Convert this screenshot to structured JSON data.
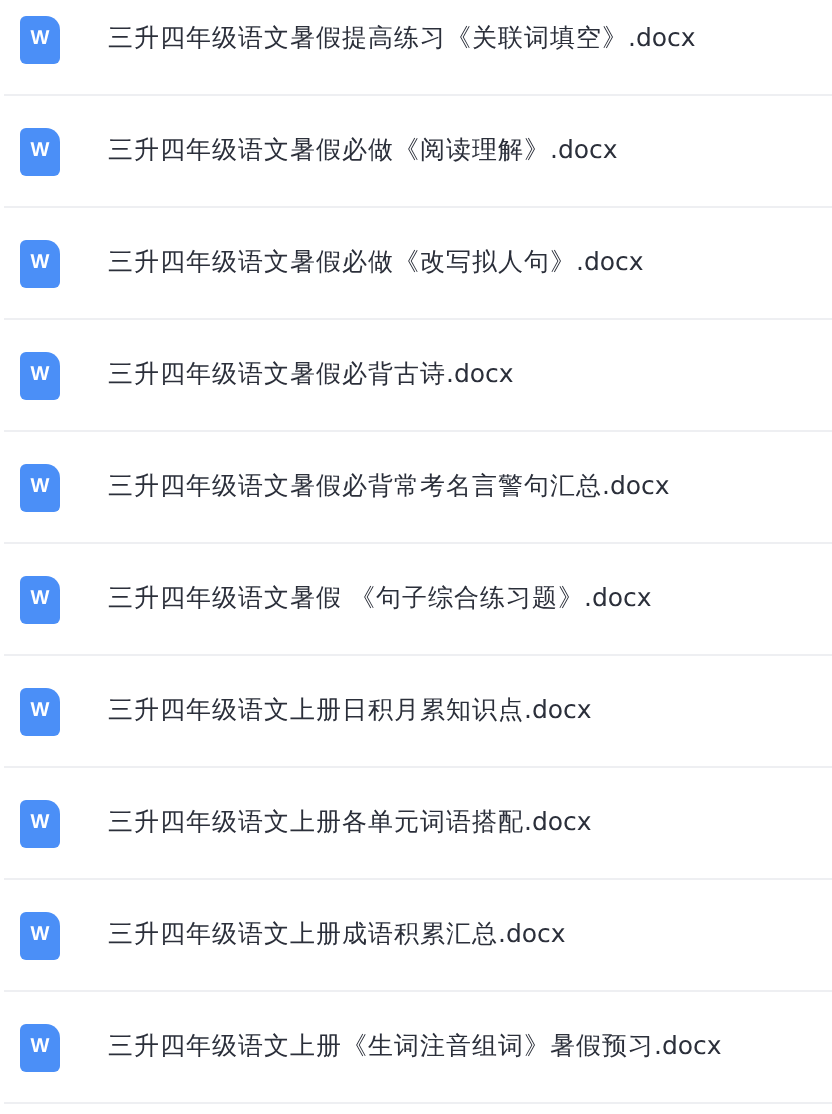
{
  "files": [
    {
      "icon_text": "W",
      "name": "三升四年级语文暑假提高练习《关联词填空》.docx"
    },
    {
      "icon_text": "W",
      "name": "三升四年级语文暑假必做《阅读理解》.docx"
    },
    {
      "icon_text": "W",
      "name": "三升四年级语文暑假必做《改写拟人句》.docx"
    },
    {
      "icon_text": "W",
      "name": "三升四年级语文暑假必背古诗.docx"
    },
    {
      "icon_text": "W",
      "name": "三升四年级语文暑假必背常考名言警句汇总.docx"
    },
    {
      "icon_text": "W",
      "name": "三升四年级语文暑假 《句子综合练习题》.docx"
    },
    {
      "icon_text": "W",
      "name": "三升四年级语文上册日积月累知识点.docx"
    },
    {
      "icon_text": "W",
      "name": "三升四年级语文上册各单元词语搭配.docx"
    },
    {
      "icon_text": "W",
      "name": "三升四年级语文上册成语积累汇总.docx"
    },
    {
      "icon_text": "W",
      "name": "三升四年级语文上册《生词注音组词》暑假预习.docx"
    }
  ]
}
